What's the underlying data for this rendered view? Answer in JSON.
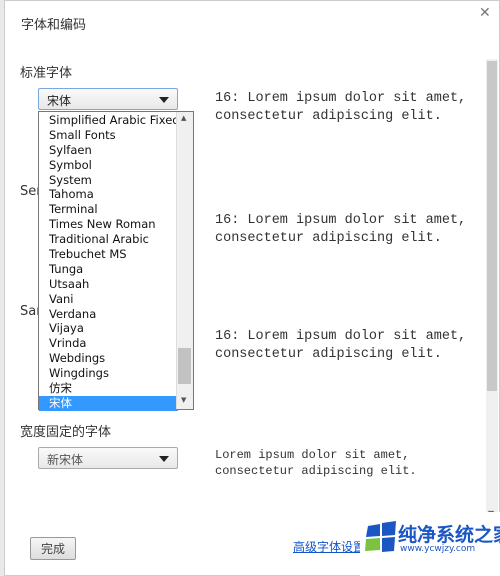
{
  "dialog": {
    "title": "字体和编码",
    "close_icon": "close-icon"
  },
  "standard": {
    "label": "标准字体",
    "selected": "宋体",
    "preview": [
      "16: Lorem ipsum dolor sit amet,",
      "consectetur adipiscing elit."
    ]
  },
  "serif": {
    "label": "Ser",
    "preview": [
      "16: Lorem ipsum dolor sit amet,",
      "consectetur adipiscing elit."
    ]
  },
  "sans": {
    "label": "San",
    "preview": [
      "16: Lorem ipsum dolor sit amet,",
      "consectetur adipiscing elit."
    ]
  },
  "fixed": {
    "label": "宽度固定的字体",
    "selected": "新宋体",
    "preview": [
      "Lorem ipsum dolor sit amet,",
      "consectetur adipiscing elit."
    ]
  },
  "dropdown": {
    "items": [
      "Simplified Arabic Fixed",
      "Small Fonts",
      "Sylfaen",
      "Symbol",
      "System",
      "Tahoma",
      "Terminal",
      "Times New Roman",
      "Traditional Arabic",
      "Trebuchet MS",
      "Tunga",
      "Utsaah",
      "Vani",
      "Verdana",
      "Vijaya",
      "Vrinda",
      "Webdings",
      "Wingdings",
      "仿宋",
      "宋体"
    ],
    "selected_index": 19,
    "highlight_color": "#3399ff"
  },
  "footer": {
    "done": "完成",
    "advanced_link": "高级字体设置"
  },
  "watermark": {
    "text": "纯净系统之家",
    "url": "www.ycwjzy.com"
  }
}
